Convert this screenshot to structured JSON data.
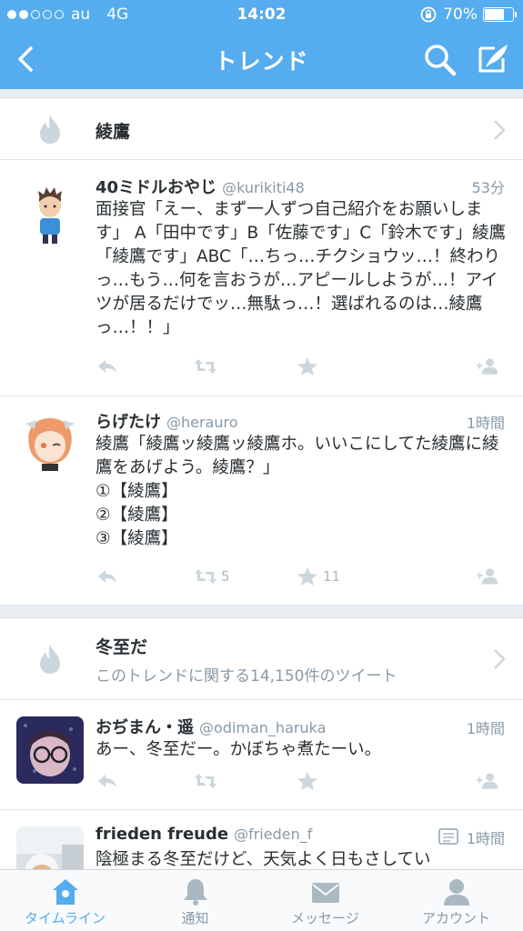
{
  "status": {
    "carrier": "au",
    "network": "4G",
    "time": "14:02",
    "battery": "70%",
    "signal_bars": 2,
    "battery_level": 0.7
  },
  "nav": {
    "title": "トレンド",
    "icons": [
      "back-icon",
      "search-icon",
      "compose-icon"
    ]
  },
  "trends": [
    {
      "name": "綾鷹",
      "subtitle": ""
    },
    {
      "name": "冬至だ",
      "subtitle": "このトレンドに関する14,150件のツイート"
    }
  ],
  "tweets": [
    {
      "name": "40ミドルおやじ",
      "handle": "@kurikiti48",
      "time": "53分",
      "text": "面接官「えー、まず一人ずつ自己紹介をお願いします」 A「田中です」B「佐藤です」C「鈴木です」綾鷹「綾鷹です」ABC「…ちっ…チクショウッ…！終わりっ…もう…何を言おうが…アピールしようが…！アイツが居るだけでッ…無駄っ…！選ばれるのは…綾鷹っ…！！」",
      "retweets": "",
      "favorites": ""
    },
    {
      "name": "らげたけ",
      "handle": "@herauro",
      "time": "1時間",
      "text": "綾鷹「綾鷹ッ綾鷹ッ綾鷹ホ。いいこにしてた綾鷹に綾鷹をあげよう。綾鷹？」\n①【綾鷹】\n②【綾鷹】\n③【綾鷹】",
      "retweets": "5",
      "favorites": "11"
    },
    {
      "name": "おぢまん・遥",
      "handle": "@odiman_haruka",
      "time": "1時間",
      "text": "あー、冬至だー。かぼちゃ煮たーい。",
      "retweets": "",
      "favorites": ""
    },
    {
      "name": "frieden freude",
      "handle": "@frieden_f",
      "time": "1時間",
      "text": "陰極まる冬至だけど、天気よく日もさしてい",
      "retweets": "",
      "favorites": ""
    }
  ],
  "tabs": [
    {
      "label": "タイムライン",
      "icon": "home-icon",
      "active": true
    },
    {
      "label": "通知",
      "icon": "bell-icon",
      "active": false
    },
    {
      "label": "メッセージ",
      "icon": "envelope-icon",
      "active": false
    },
    {
      "label": "アカウント",
      "icon": "person-icon",
      "active": false
    }
  ],
  "colors": {
    "brand": "#55acee",
    "muted": "#8899a6",
    "icon_gray": "#aab8c2"
  }
}
